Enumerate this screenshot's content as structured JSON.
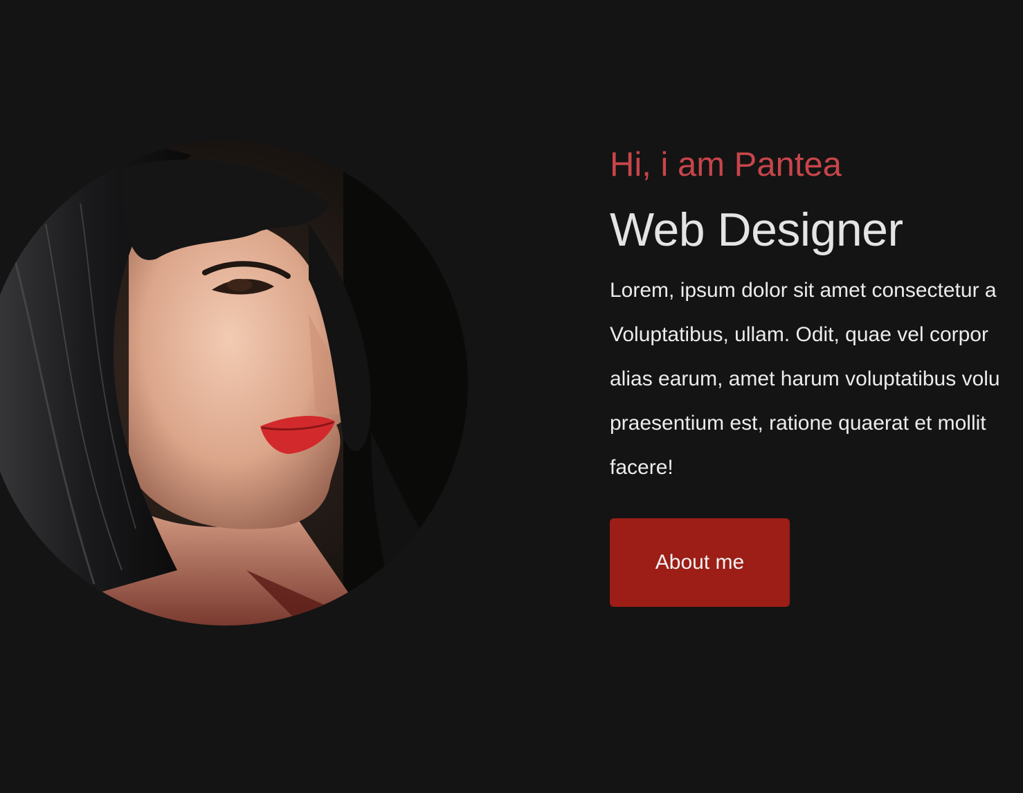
{
  "hero": {
    "greeting": "Hi, i am Pantea",
    "role": "Web Designer",
    "description_lines": [
      "Lorem, ipsum dolor sit amet consectetur a",
      "Voluptatibus, ullam. Odit, quae vel corpor",
      "alias earum, amet harum voluptatibus volu",
      "praesentium est, ratione quaerat et mollit",
      "facere!"
    ],
    "cta_label": "About me"
  },
  "colors": {
    "background": "#141414",
    "accent": "#c8454a",
    "button": "#9c1e16",
    "heading": "#e4e4e4",
    "body_text": "#ececec"
  }
}
